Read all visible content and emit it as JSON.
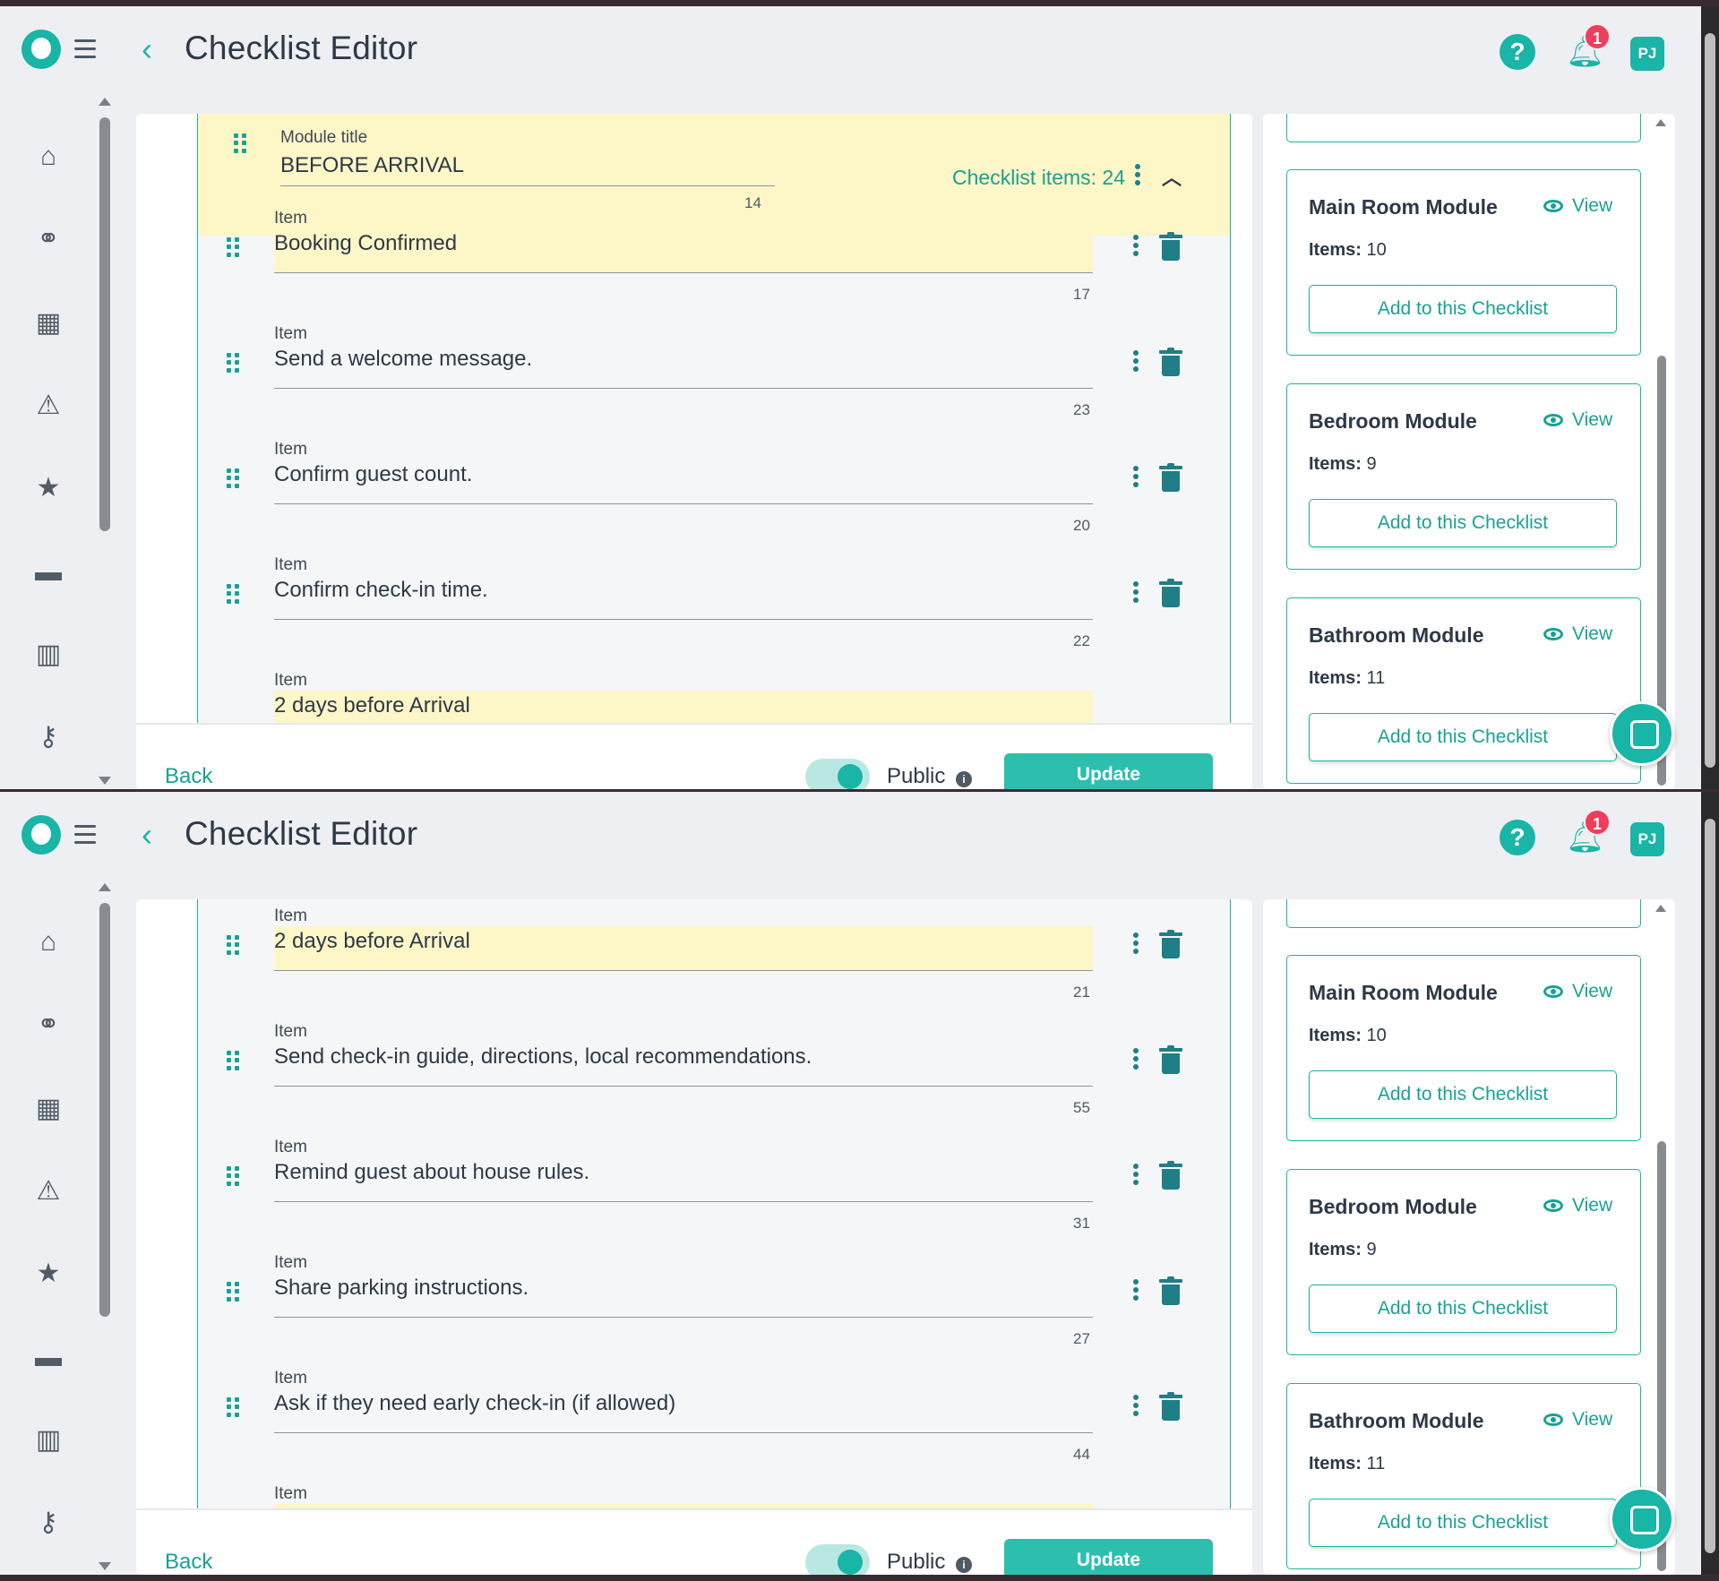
{
  "header": {
    "title": "Checklist Editor",
    "notification_count": "1",
    "avatar_initials": "PJ",
    "icons": {
      "back": "chevron-left-icon",
      "help": "question-icon",
      "bell": "bell-icon"
    }
  },
  "nav": {
    "icons": [
      "home-icon",
      "handshake-icon",
      "calendar-icon",
      "warning-icon",
      "star-icon",
      "credit-card-icon",
      "building-icon",
      "key-icon"
    ]
  },
  "module": {
    "title_label": "Module title",
    "title_value": "BEFORE ARRIVAL",
    "title_char_count": "14",
    "checklist_items": "Checklist items: 24"
  },
  "screen1_items": [
    {
      "label": "Item",
      "value": "Booking Confirmed",
      "count": "17",
      "highlighted": true
    },
    {
      "label": "Item",
      "value": "Send a welcome message.",
      "count": "23",
      "highlighted": false
    },
    {
      "label": "Item",
      "value": "Confirm guest count.",
      "count": "20",
      "highlighted": false
    },
    {
      "label": "Item",
      "value": "Confirm check-in time.",
      "count": "22",
      "highlighted": false
    },
    {
      "label": "Item",
      "value": "2 days before Arrival",
      "count": "",
      "highlighted": true
    }
  ],
  "screen2_items": [
    {
      "label": "Item",
      "value": "2 days before Arrival",
      "count": "21",
      "highlighted": true
    },
    {
      "label": "Item",
      "value": "Send check-in guide, directions, local recommendations.",
      "count": "55",
      "highlighted": false
    },
    {
      "label": "Item",
      "value": "Remind guest about house rules.",
      "count": "31",
      "highlighted": false
    },
    {
      "label": "Item",
      "value": "Share parking instructions.",
      "count": "27",
      "highlighted": false
    },
    {
      "label": "Item",
      "value": "Ask if they need early check-in (if allowed)",
      "count": "44",
      "highlighted": false
    },
    {
      "label": "Item",
      "value": "",
      "count": "",
      "highlighted": true
    }
  ],
  "footer": {
    "back_label": "Back",
    "public_label": "Public",
    "public_enabled": true,
    "update_label": "Update"
  },
  "modules_panel": [
    {
      "name": "Main Room Module",
      "view_label": "View",
      "items_label": "Items:",
      "items_count": "10",
      "add_label": "Add to this Checklist"
    },
    {
      "name": "Bedroom Module",
      "view_label": "View",
      "items_label": "Items:",
      "items_count": "9",
      "add_label": "Add to this Checklist"
    },
    {
      "name": "Bathroom Module",
      "view_label": "View",
      "items_label": "Items:",
      "items_count": "11",
      "add_label": "Add to this Checklist"
    }
  ],
  "colors": {
    "accent": "#19b5a6",
    "highlight": "#fdf6c7",
    "badge": "#ef3e5c",
    "update_button": "#2cbfae"
  }
}
